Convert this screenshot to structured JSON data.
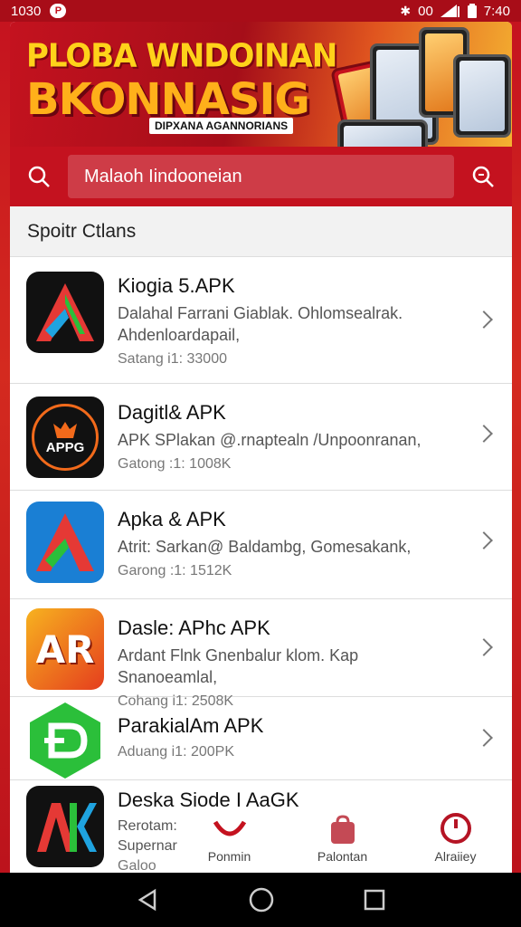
{
  "status_bar": {
    "time_left": "1030",
    "time_right": "7:40",
    "indicator": "00"
  },
  "banner": {
    "line1": "PLOBA WNDOINAN",
    "line2": "BKONNASIG",
    "tag": "DIPXANA AGANNORIANS"
  },
  "search": {
    "value": "Malaoh Iindooneian"
  },
  "section": {
    "title": "Spoitr Ctlans"
  },
  "items": [
    {
      "title": "Kiogia 5.APK",
      "desc": "Dalahal Farrani Giablak. Ohlomsealrak. Ahdenloardapail,",
      "meta": "Satang i1: 33000",
      "icon_text": "A",
      "icon_bg": "#111111",
      "icon_color": "#e53935"
    },
    {
      "title": "Dagitl& APK",
      "desc": "APK SPlakan @.rnaptealn /Unpoonranan,",
      "meta": "Gatong :1: 1008K",
      "icon_text": "APPG",
      "icon_bg": "#111111",
      "icon_color": "#f26a1b"
    },
    {
      "title": "Apka & APK",
      "desc": "Atrit: Sarkan@ Baldambg, Gomesakank,",
      "meta": "Garong :1: 1512K",
      "icon_text": "A",
      "icon_bg": "#1a7fd4",
      "icon_color": "#e53935"
    },
    {
      "title": "Dasle: APhc APK",
      "desc": "Ardant Flnk Gnenbalur klom. Kap Snanoeamlal,",
      "meta": "Cohang i1: 2508K",
      "icon_text": "AR",
      "icon_bg": "#f57c1f",
      "icon_color": "#ffffff"
    },
    {
      "title": "ParakialAm APK",
      "desc": "",
      "meta": "Aduang i1: 200PK",
      "icon_text": "D",
      "icon_bg": "#2bbf3a",
      "icon_color": "#ffffff"
    },
    {
      "title": "Deska Siode I AaGK",
      "desc": "Rerotam: Supernar",
      "meta": "Galoo",
      "icon_text": "AK",
      "icon_bg": "#111111",
      "icon_color": "#ffffff"
    }
  ],
  "bottom_nav": [
    {
      "label": "Ponmin",
      "icon": "horseshoe-icon",
      "color": "#c4121f"
    },
    {
      "label": "Palontan",
      "icon": "bag-icon",
      "color": "#c44a55"
    },
    {
      "label": "Alraiiey",
      "icon": "timer-icon",
      "color": "#b51424"
    }
  ],
  "colors": {
    "brand_red": "#c4121f",
    "banner_yellow": "#ffd21a"
  }
}
